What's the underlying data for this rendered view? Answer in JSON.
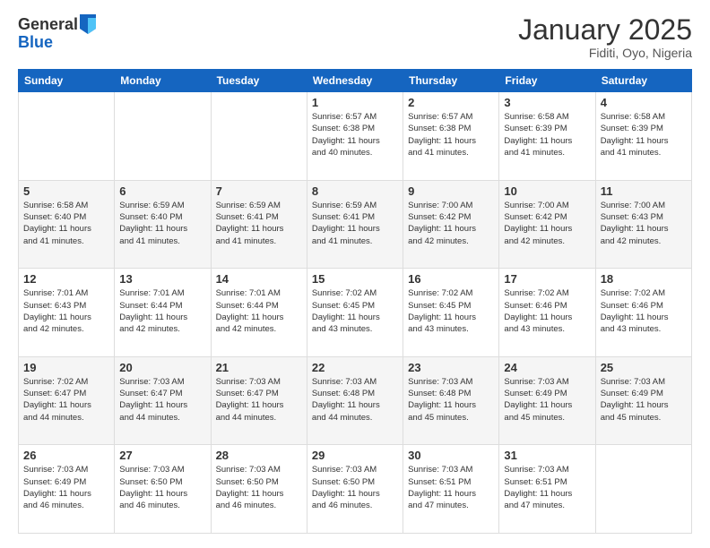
{
  "logo": {
    "general": "General",
    "blue": "Blue"
  },
  "header": {
    "month": "January 2025",
    "location": "Fiditi, Oyo, Nigeria"
  },
  "days": [
    "Sunday",
    "Monday",
    "Tuesday",
    "Wednesday",
    "Thursday",
    "Friday",
    "Saturday"
  ],
  "weeks": [
    [
      {
        "day": "",
        "info": ""
      },
      {
        "day": "",
        "info": ""
      },
      {
        "day": "",
        "info": ""
      },
      {
        "day": "1",
        "info": "Sunrise: 6:57 AM\nSunset: 6:38 PM\nDaylight: 11 hours\nand 40 minutes."
      },
      {
        "day": "2",
        "info": "Sunrise: 6:57 AM\nSunset: 6:38 PM\nDaylight: 11 hours\nand 41 minutes."
      },
      {
        "day": "3",
        "info": "Sunrise: 6:58 AM\nSunset: 6:39 PM\nDaylight: 11 hours\nand 41 minutes."
      },
      {
        "day": "4",
        "info": "Sunrise: 6:58 AM\nSunset: 6:39 PM\nDaylight: 11 hours\nand 41 minutes."
      }
    ],
    [
      {
        "day": "5",
        "info": "Sunrise: 6:58 AM\nSunset: 6:40 PM\nDaylight: 11 hours\nand 41 minutes."
      },
      {
        "day": "6",
        "info": "Sunrise: 6:59 AM\nSunset: 6:40 PM\nDaylight: 11 hours\nand 41 minutes."
      },
      {
        "day": "7",
        "info": "Sunrise: 6:59 AM\nSunset: 6:41 PM\nDaylight: 11 hours\nand 41 minutes."
      },
      {
        "day": "8",
        "info": "Sunrise: 6:59 AM\nSunset: 6:41 PM\nDaylight: 11 hours\nand 41 minutes."
      },
      {
        "day": "9",
        "info": "Sunrise: 7:00 AM\nSunset: 6:42 PM\nDaylight: 11 hours\nand 42 minutes."
      },
      {
        "day": "10",
        "info": "Sunrise: 7:00 AM\nSunset: 6:42 PM\nDaylight: 11 hours\nand 42 minutes."
      },
      {
        "day": "11",
        "info": "Sunrise: 7:00 AM\nSunset: 6:43 PM\nDaylight: 11 hours\nand 42 minutes."
      }
    ],
    [
      {
        "day": "12",
        "info": "Sunrise: 7:01 AM\nSunset: 6:43 PM\nDaylight: 11 hours\nand 42 minutes."
      },
      {
        "day": "13",
        "info": "Sunrise: 7:01 AM\nSunset: 6:44 PM\nDaylight: 11 hours\nand 42 minutes."
      },
      {
        "day": "14",
        "info": "Sunrise: 7:01 AM\nSunset: 6:44 PM\nDaylight: 11 hours\nand 42 minutes."
      },
      {
        "day": "15",
        "info": "Sunrise: 7:02 AM\nSunset: 6:45 PM\nDaylight: 11 hours\nand 43 minutes."
      },
      {
        "day": "16",
        "info": "Sunrise: 7:02 AM\nSunset: 6:45 PM\nDaylight: 11 hours\nand 43 minutes."
      },
      {
        "day": "17",
        "info": "Sunrise: 7:02 AM\nSunset: 6:46 PM\nDaylight: 11 hours\nand 43 minutes."
      },
      {
        "day": "18",
        "info": "Sunrise: 7:02 AM\nSunset: 6:46 PM\nDaylight: 11 hours\nand 43 minutes."
      }
    ],
    [
      {
        "day": "19",
        "info": "Sunrise: 7:02 AM\nSunset: 6:47 PM\nDaylight: 11 hours\nand 44 minutes."
      },
      {
        "day": "20",
        "info": "Sunrise: 7:03 AM\nSunset: 6:47 PM\nDaylight: 11 hours\nand 44 minutes."
      },
      {
        "day": "21",
        "info": "Sunrise: 7:03 AM\nSunset: 6:47 PM\nDaylight: 11 hours\nand 44 minutes."
      },
      {
        "day": "22",
        "info": "Sunrise: 7:03 AM\nSunset: 6:48 PM\nDaylight: 11 hours\nand 44 minutes."
      },
      {
        "day": "23",
        "info": "Sunrise: 7:03 AM\nSunset: 6:48 PM\nDaylight: 11 hours\nand 45 minutes."
      },
      {
        "day": "24",
        "info": "Sunrise: 7:03 AM\nSunset: 6:49 PM\nDaylight: 11 hours\nand 45 minutes."
      },
      {
        "day": "25",
        "info": "Sunrise: 7:03 AM\nSunset: 6:49 PM\nDaylight: 11 hours\nand 45 minutes."
      }
    ],
    [
      {
        "day": "26",
        "info": "Sunrise: 7:03 AM\nSunset: 6:49 PM\nDaylight: 11 hours\nand 46 minutes."
      },
      {
        "day": "27",
        "info": "Sunrise: 7:03 AM\nSunset: 6:50 PM\nDaylight: 11 hours\nand 46 minutes."
      },
      {
        "day": "28",
        "info": "Sunrise: 7:03 AM\nSunset: 6:50 PM\nDaylight: 11 hours\nand 46 minutes."
      },
      {
        "day": "29",
        "info": "Sunrise: 7:03 AM\nSunset: 6:50 PM\nDaylight: 11 hours\nand 46 minutes."
      },
      {
        "day": "30",
        "info": "Sunrise: 7:03 AM\nSunset: 6:51 PM\nDaylight: 11 hours\nand 47 minutes."
      },
      {
        "day": "31",
        "info": "Sunrise: 7:03 AM\nSunset: 6:51 PM\nDaylight: 11 hours\nand 47 minutes."
      },
      {
        "day": "",
        "info": ""
      }
    ]
  ]
}
